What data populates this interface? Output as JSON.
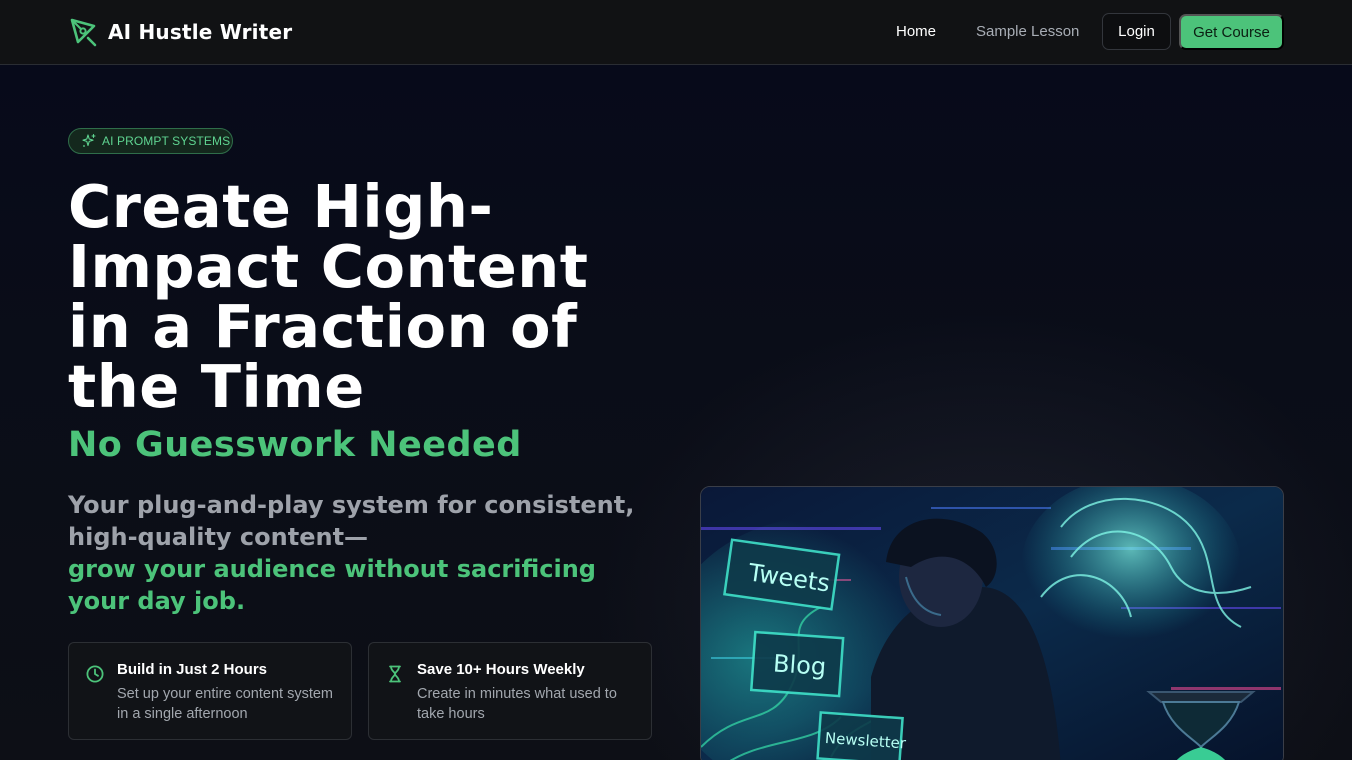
{
  "nav": {
    "brand": "AI Hustle Writer",
    "links": {
      "home": "Home",
      "sample": "Sample Lesson"
    },
    "login": "Login",
    "cta": "Get Course"
  },
  "hero": {
    "badge": "AI PROMPT SYSTEMS",
    "headline": "Create High-Impact Content in a Fraction of the Time",
    "subheadline": "No Guesswork Needed",
    "desc_main": "Your plug-and-play system for consistent, high-quality content—",
    "desc_highlight": "grow your audience without sacrificing your day job.",
    "features": [
      {
        "title": "Build in Just 2 Hours",
        "text": "Set up your entire content system in a single afternoon",
        "icon": "clock-icon"
      },
      {
        "title": "Save 10+ Hours Weekly",
        "text": "Create in minutes what used to take hours",
        "icon": "hourglass-icon"
      }
    ]
  },
  "illustration": {
    "signs": [
      "Tweets",
      "Blog",
      "Newsletter"
    ]
  },
  "colors": {
    "accent": "#4cc37a",
    "background": "#0b0e17",
    "nav": "#111214"
  }
}
